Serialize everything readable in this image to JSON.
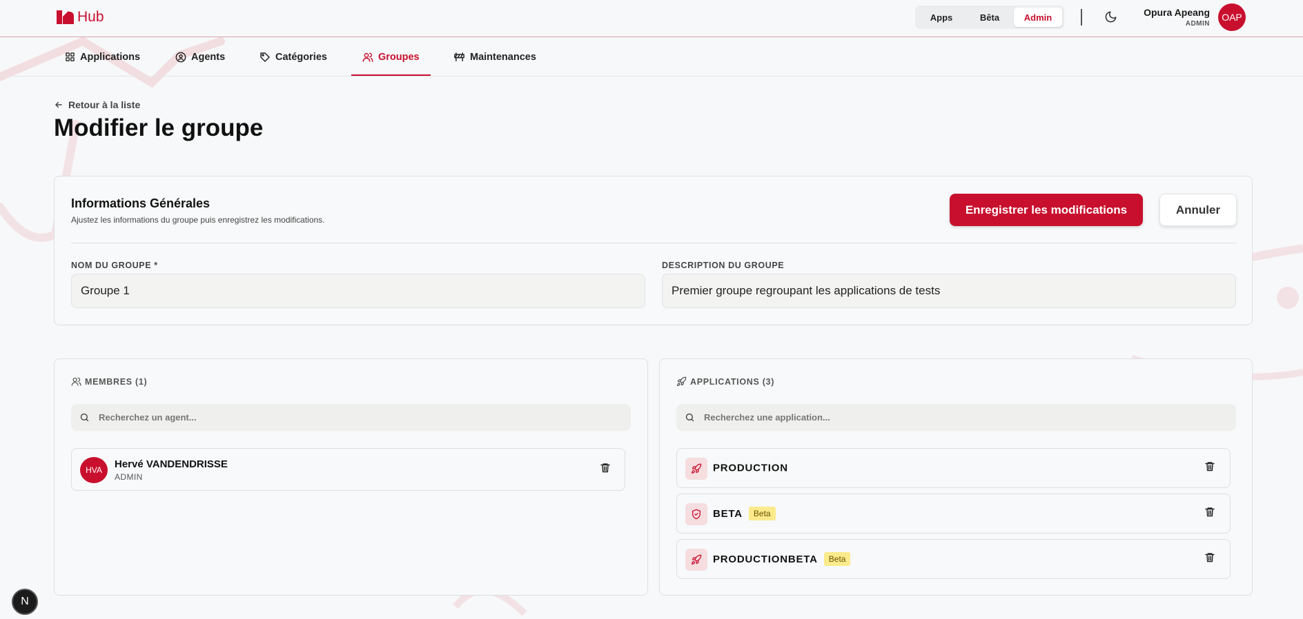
{
  "header": {
    "logo_text": "Hub",
    "env_switch": {
      "apps": "Apps",
      "beta": "Bêta",
      "admin": "Admin"
    },
    "user": {
      "name": "Opura Apeang",
      "role": "ADMIN",
      "initials": "OAP"
    }
  },
  "nav": {
    "items": [
      {
        "label": "Applications",
        "icon": "grid-icon"
      },
      {
        "label": "Agents",
        "icon": "user-circle-icon"
      },
      {
        "label": "Catégories",
        "icon": "tag-icon"
      },
      {
        "label": "Groupes",
        "icon": "users-icon",
        "active": true
      },
      {
        "label": "Maintenances",
        "icon": "barrier-icon"
      }
    ]
  },
  "page": {
    "back_label": "Retour à la liste",
    "title": "Modifier le groupe"
  },
  "info": {
    "title": "Informations Générales",
    "subtitle": "Ajustez les informations du groupe puis enregistrez les modifications.",
    "save_label": "Enregistrer les modifications",
    "cancel_label": "Annuler",
    "name_label": "NOM DU GROUPE *",
    "name_value": "Groupe 1",
    "description_label": "DESCRIPTION DU GROUPE",
    "description_value": "Premier groupe regroupant les applications de tests"
  },
  "members": {
    "heading": "MEMBRES (1)",
    "search_placeholder": "Recherchez un agent...",
    "items": [
      {
        "initials": "HVA",
        "name": "Hervé VANDENDRISSE",
        "role": "ADMIN"
      }
    ]
  },
  "applications": {
    "heading": "APPLICATIONS (3)",
    "search_placeholder": "Recherchez une application...",
    "items": [
      {
        "name": "PRODUCTION",
        "icon": "rocket-icon",
        "badge": ""
      },
      {
        "name": "BETA",
        "icon": "shield-icon",
        "badge": "Beta"
      },
      {
        "name": "PRODUCTIONBETA",
        "icon": "rocket-icon",
        "badge": "Beta"
      }
    ]
  },
  "dev_badge": "N",
  "colors": {
    "accent": "#c8102e",
    "badge_bg": "#fbeb8c"
  }
}
